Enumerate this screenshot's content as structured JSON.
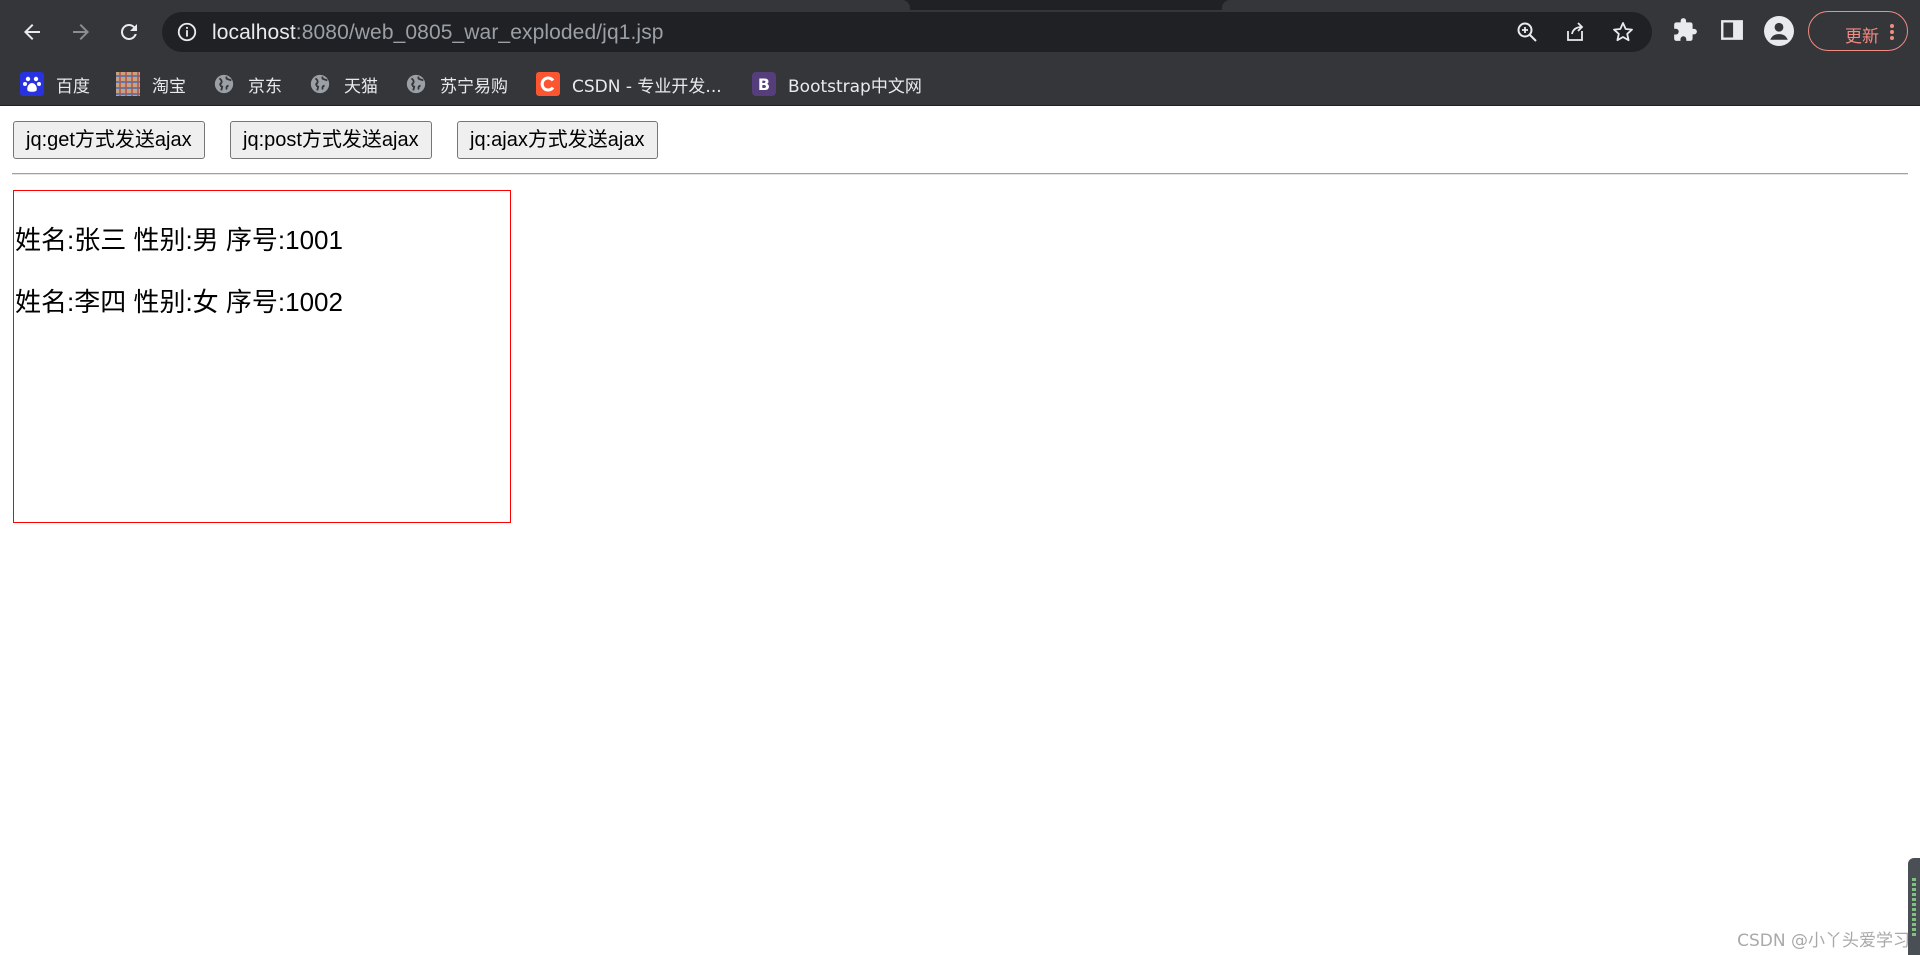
{
  "browser": {
    "url_host": "localhost",
    "url_rest": ":8080/web_0805_war_exploded/jq1.jsp",
    "update_label": "更新",
    "icons": [
      "back-icon",
      "forward-icon",
      "reload-icon",
      "info-icon",
      "zoom-icon",
      "share-icon",
      "star-icon",
      "extensions-icon",
      "side-panel-icon",
      "profile-icon",
      "menu-dots-icon"
    ]
  },
  "bookmarks": [
    {
      "label": "百度",
      "icon": "baidu-icon"
    },
    {
      "label": "淘宝",
      "icon": "taobao-icon"
    },
    {
      "label": "京东",
      "icon": "globe-icon"
    },
    {
      "label": "天猫",
      "icon": "globe-icon"
    },
    {
      "label": "苏宁易购",
      "icon": "globe-icon"
    },
    {
      "label": "CSDN - 专业开发...",
      "icon": "csdn-icon"
    },
    {
      "label": "Bootstrap中文网",
      "icon": "bootstrap-icon"
    }
  ],
  "page": {
    "buttons": [
      {
        "label": "jq:get方式发送ajax"
      },
      {
        "label": "jq:post方式发送ajax"
      },
      {
        "label": "jq:ajax方式发送ajax"
      }
    ],
    "results": [
      "姓名:张三 性别:男 序号:1001",
      "姓名:李四 性别:女 序号:1002"
    ]
  },
  "watermark": "CSDN @小丫头爱学习",
  "colors": {
    "chrome_dark": "#35363a",
    "omnibox": "#202124",
    "update_accent": "#f28b82",
    "result_border": "#ff0000"
  }
}
